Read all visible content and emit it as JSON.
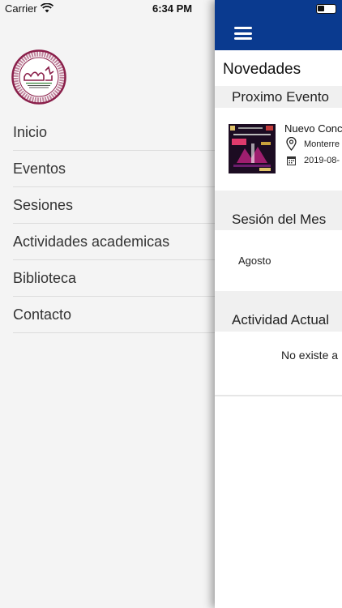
{
  "status_bar": {
    "carrier": "Carrier",
    "time": "6:34 PM"
  },
  "drawer": {
    "logo_text": "Colegio de Medicina Familiar del Estado de Nuevo León, A.C.",
    "menu": [
      {
        "label": "Inicio"
      },
      {
        "label": "Eventos"
      },
      {
        "label": "Sesiones"
      },
      {
        "label": "Actividades academicas"
      },
      {
        "label": "Biblioteca"
      },
      {
        "label": "Contacto"
      }
    ]
  },
  "main": {
    "title": "Novedades",
    "event_section": {
      "heading": "Proximo Evento",
      "name": "Nuevo Conc",
      "location": "Monterre",
      "date": "2019-08-"
    },
    "session_section": {
      "heading": "Sesión del Mes",
      "month": "Agosto"
    },
    "activity_section": {
      "heading": "Actividad Actual",
      "empty_text": "No existe a"
    }
  },
  "colors": {
    "navbar": "#0a3a8f",
    "logo": "#8a1f4a"
  }
}
